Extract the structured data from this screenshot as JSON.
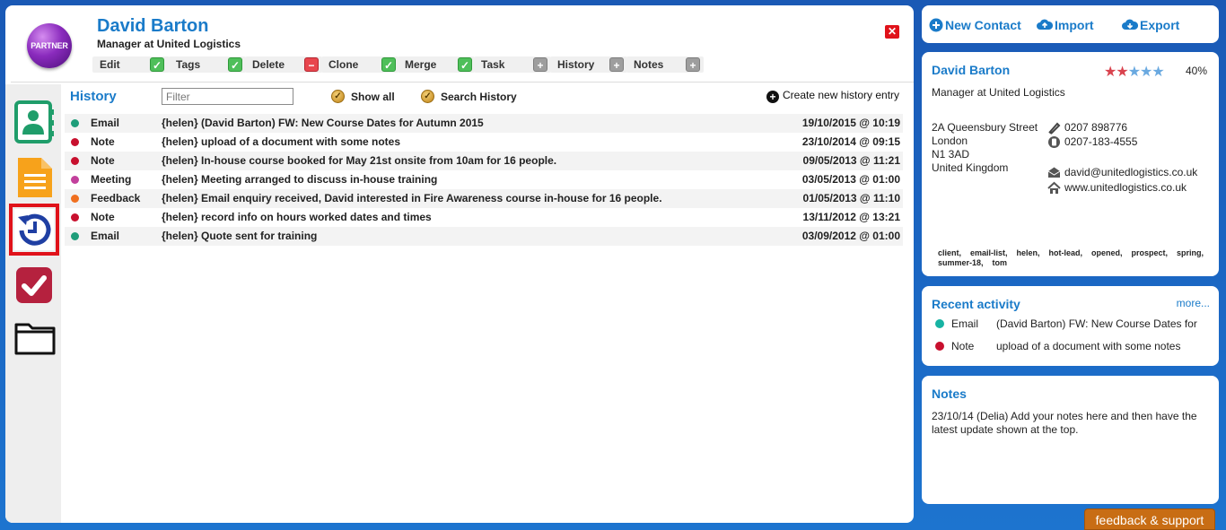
{
  "contact": {
    "badge": "PARTNER",
    "name": "David Barton",
    "role": "Manager at United Logistics",
    "close_symbol": "✕"
  },
  "toolbar": [
    {
      "label": "Edit",
      "icon": "check-icon",
      "state": "green"
    },
    {
      "label": "Tags",
      "icon": "check-icon",
      "state": "green"
    },
    {
      "label": "Delete",
      "icon": "minus-icon",
      "state": "red"
    },
    {
      "label": "Clone",
      "icon": "check-icon",
      "state": "green"
    },
    {
      "label": "Merge",
      "icon": "check-icon",
      "state": "green"
    },
    {
      "label": "Task",
      "icon": "plus-icon",
      "state": "grey"
    },
    {
      "label": "History",
      "icon": "plus-icon",
      "state": "grey"
    },
    {
      "label": "Notes",
      "icon": "plus-icon",
      "state": "grey"
    }
  ],
  "rail": [
    {
      "name": "contact-card-icon",
      "active": false
    },
    {
      "name": "document-icon",
      "active": false
    },
    {
      "name": "history-icon",
      "active": true
    },
    {
      "name": "task-check-icon",
      "active": false
    },
    {
      "name": "folder-icon",
      "active": false
    }
  ],
  "history": {
    "title": "History",
    "filter_placeholder": "Filter",
    "show_all": "Show all",
    "search_history": "Search History",
    "create_entry": "Create new history entry",
    "rows": [
      {
        "type": "Email",
        "color": "#1f9d7a",
        "desc": "{helen} (David Barton) FW: New Course Dates for Autumn 2015",
        "date": "19/10/2015 @ 10:19"
      },
      {
        "type": "Note",
        "color": "#c8102e",
        "desc": "{helen} upload of a document with some notes",
        "date": "23/10/2014 @ 09:15"
      },
      {
        "type": "Note",
        "color": "#c8102e",
        "desc": "{helen} In-house course booked for May 21st onsite from 10am for 16 people.",
        "date": "09/05/2013 @ 11:21"
      },
      {
        "type": "Meeting",
        "color": "#c2409c",
        "desc": "{helen} Meeting arranged to discuss in-house training",
        "date": "03/05/2013 @ 01:00"
      },
      {
        "type": "Feedback",
        "color": "#f07020",
        "desc": "{helen} Email enquiry received, David interested in Fire Awareness course in-house for 16 people.",
        "date": "01/05/2013 @ 11:10"
      },
      {
        "type": "Note",
        "color": "#c8102e",
        "desc": "{helen} record info on hours worked dates and times",
        "date": "13/11/2012 @ 13:21"
      },
      {
        "type": "Email",
        "color": "#1f9d7a",
        "desc": "{helen} Quote sent for training",
        "date": "03/09/2012 @ 01:00"
      }
    ]
  },
  "actions": {
    "new_contact": "New Contact",
    "import": "Import",
    "export": "Export"
  },
  "card": {
    "name": "David Barton",
    "stars": "★★★★★",
    "rating": "40%",
    "role": "Manager at United Logistics",
    "address": [
      "2A Queensbury Street",
      "London",
      "N1 3AD",
      "United Kingdom"
    ],
    "phone": "0207 898776",
    "fax": "0207-183-4555",
    "email": "david@unitedlogistics.co.uk",
    "website": "www.unitedlogistics.co.uk",
    "tags": "client,    email-list,    helen,    hot-lead,    opened,    prospect,    spring,    summer-18,    tom"
  },
  "recent": {
    "title": "Recent activity",
    "more": "more...",
    "items": [
      {
        "type": "Email",
        "color": "#17b3a3",
        "desc": "(David Barton) FW: New Course Dates for"
      },
      {
        "type": "Note",
        "color": "#c8102e",
        "desc": "upload of a document with some notes"
      }
    ]
  },
  "notes": {
    "title": "Notes",
    "text": "23/10/14 (Delia) Add your notes here and then have the latest update shown at the top."
  },
  "feedback": "feedback & support"
}
